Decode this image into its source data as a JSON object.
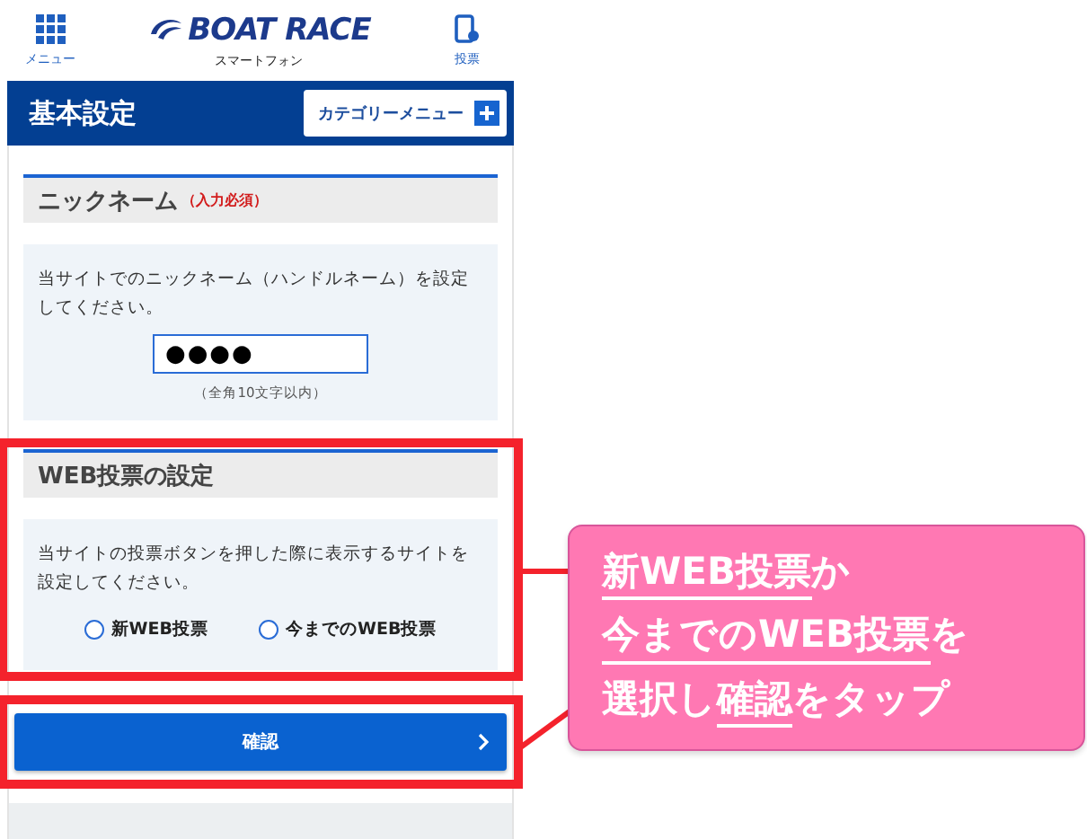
{
  "header": {
    "menu_label": "メニュー",
    "logo_text": "BOAT RACE",
    "logo_subtitle": "スマートフォン",
    "vote_label": "投票"
  },
  "title_bar": {
    "title": "基本設定",
    "category_button": "カテゴリーメニュー"
  },
  "sections": [
    {
      "kind": "text_input",
      "heading": "ニックネーム",
      "required_note": "（入力必須）",
      "description": "当サイトでのニックネーム（ハンドルネーム）を設定してください。",
      "value": "●●●●",
      "hint": "（全角10文字以内）",
      "highlighted": false
    },
    {
      "kind": "radio",
      "heading": "WEB投票の設定",
      "description": "当サイトの投票ボタンを押した際に表示するサイトを設定してください。",
      "options": [
        {
          "label": "新WEB投票",
          "selected": false
        },
        {
          "label": "今までのWEB投票",
          "selected": false
        }
      ],
      "highlighted": true
    }
  ],
  "confirm_button": {
    "label": "確認",
    "highlighted": true
  },
  "callout": {
    "lines": [
      [
        {
          "text": "新WEB投票",
          "underline": true
        },
        {
          "text": "か",
          "underline": false
        }
      ],
      [
        {
          "text": "今までのWEB投票",
          "underline": true
        },
        {
          "text": "を",
          "underline": false
        }
      ],
      [
        {
          "text": "選択し",
          "underline": false
        },
        {
          "text": "確認",
          "underline": true
        },
        {
          "text": "をタップ",
          "underline": false
        }
      ]
    ]
  }
}
